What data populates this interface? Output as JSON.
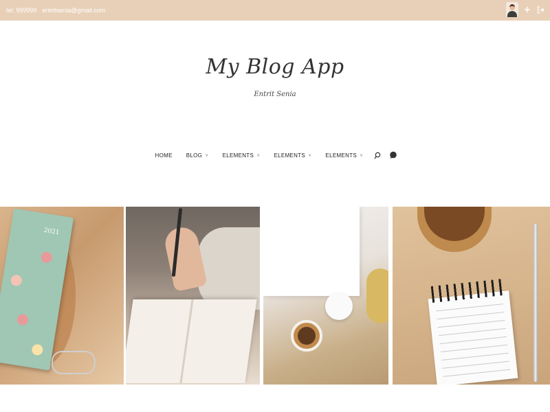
{
  "topbar": {
    "phone": "tel: 999999",
    "email": "entritsenia@gmail.com",
    "background_color": "#e8d0b8"
  },
  "header": {
    "title": "My Blog App",
    "subtitle": "Entrit Senia"
  },
  "nav": {
    "items": [
      {
        "label": "HOME",
        "has_dropdown": false
      },
      {
        "label": "BLOG",
        "has_dropdown": true
      },
      {
        "label": "ELEMENTS",
        "has_dropdown": true
      },
      {
        "label": "ELEMENTS",
        "has_dropdown": true
      },
      {
        "label": "ELEMENTS",
        "has_dropdown": true
      }
    ],
    "icons": [
      "search-icon",
      "chat-icon"
    ]
  },
  "topbar_icons": [
    "user-avatar",
    "plus-icon",
    "logout-icon"
  ],
  "gallery": {
    "tiles": [
      {
        "subject": "notebook-2021-with-dried-flowers",
        "year_label": "2021"
      },
      {
        "subject": "hand-writing-in-notebook"
      },
      {
        "subject": "coffee-and-candle-on-rug"
      },
      {
        "subject": "spiral-notepad-and-pen"
      }
    ]
  }
}
